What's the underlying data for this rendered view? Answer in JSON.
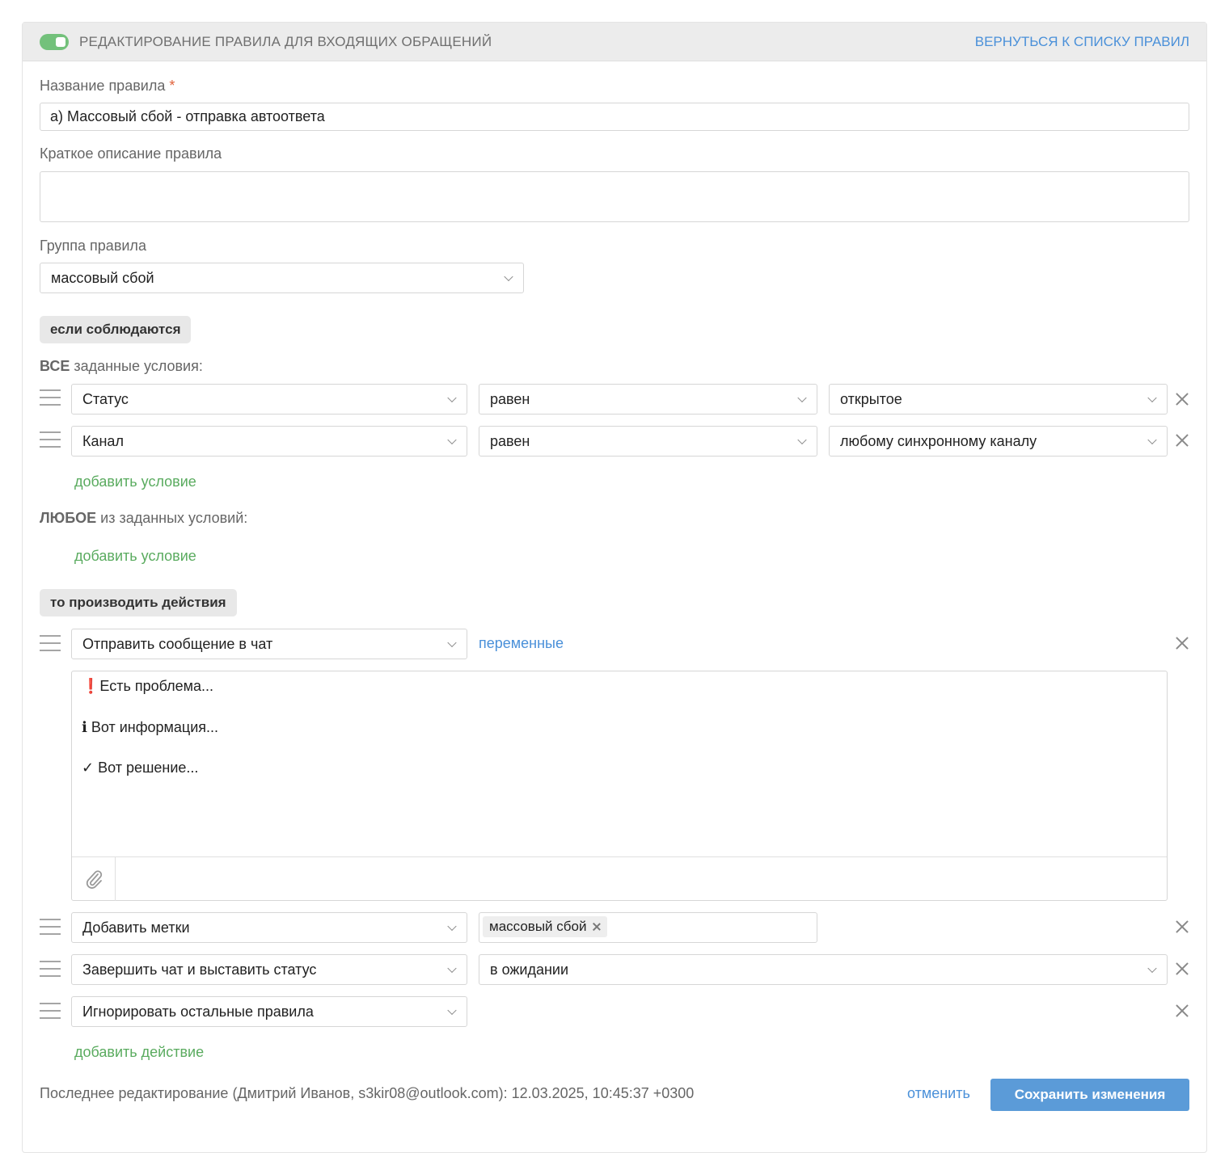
{
  "header": {
    "title": "РЕДАКТИРОВАНИЕ ПРАВИЛА ДЛЯ ВХОДЯЩИХ ОБРАЩЕНИЙ",
    "back_link": "ВЕРНУТЬСЯ К СПИСКУ ПРАВИЛ",
    "toggle_on": true
  },
  "form": {
    "name_label": "Название правила",
    "required_mark": "*",
    "name_value": "а) Массовый сбой - отправка автоответа",
    "description_label": "Краткое описание правила",
    "description_value": "",
    "group_label": "Группа правила",
    "group_value": "массовый сбой"
  },
  "conditions": {
    "section_label": "если соблюдаются",
    "all_bold": "ВСЕ",
    "all_rest": "заданные условия:",
    "all_rows": [
      {
        "field": "Статус",
        "operator": "равен",
        "value": "открытое"
      },
      {
        "field": "Канал",
        "operator": "равен",
        "value": "любому синхронному каналу"
      }
    ],
    "add_condition": "добавить условие",
    "any_bold": "ЛЮБОЕ",
    "any_rest": "из заданных условий:",
    "add_condition_any": "добавить условие"
  },
  "actions": {
    "section_label": "то производить действия",
    "send_message": "Отправить сообщение в чат",
    "variables_link": "переменные",
    "message_lines": [
      "❗Есть проблема...",
      "ℹ Вот информация...",
      "✓ Вот решение..."
    ],
    "add_tags": "Добавить метки",
    "tag": "массовый сбой",
    "finish_chat": "Завершить чат и выставить статус",
    "finish_status": "в ожидании",
    "ignore_rules": "Игнорировать остальные правила",
    "add_action": "добавить действие"
  },
  "footer": {
    "last_edit": "Последнее редактирование (Дмитрий Иванов, s3kir08@outlook.com): 12.03.2025, 10:45:37 +0300",
    "cancel": "отменить",
    "save": "Сохранить изменения"
  },
  "colors": {
    "accent_blue": "#4a90d9",
    "link_green": "#5aab5f",
    "toggle_green": "#73c17b",
    "save_button": "#5b9bd8"
  }
}
